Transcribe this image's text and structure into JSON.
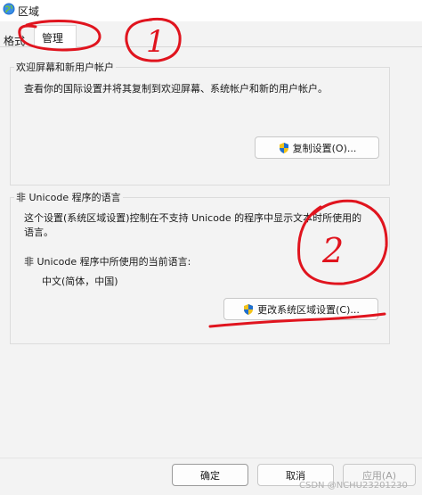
{
  "window": {
    "title": "区域",
    "icon": "globe-icon"
  },
  "tabs": [
    {
      "label": "格式",
      "selected": false
    },
    {
      "label": "管理",
      "selected": true
    }
  ],
  "welcome_group": {
    "title": "欢迎屏幕和新用户帐户",
    "description": "查看你的国际设置并将其复制到欢迎屏幕、系统帐户和新的用户帐户。",
    "copy_button": "复制设置(O)..."
  },
  "unicode_group": {
    "title": "非 Unicode 程序的语言",
    "description_line1": "这个设置(系统区域设置)控制在不支持 Unicode 的程序中显示文本时所使用的",
    "description_line2": "语言。",
    "current_label": "非 Unicode 程序中所使用的当前语言:",
    "current_value": "中文(简体，中国)",
    "change_button": "更改系统区域设置(C)..."
  },
  "footer": {
    "ok": "确定",
    "cancel": "取消",
    "apply": "应用(A)"
  },
  "annotations": {
    "mark1": "1",
    "mark2": "2",
    "color": "#e0141e"
  },
  "watermark": "CSDN @NCHU23201230",
  "colors": {
    "accent_blue": "#1e6fd0",
    "shield_yellow": "#f2c21b",
    "ink_red": "#e0141e"
  }
}
